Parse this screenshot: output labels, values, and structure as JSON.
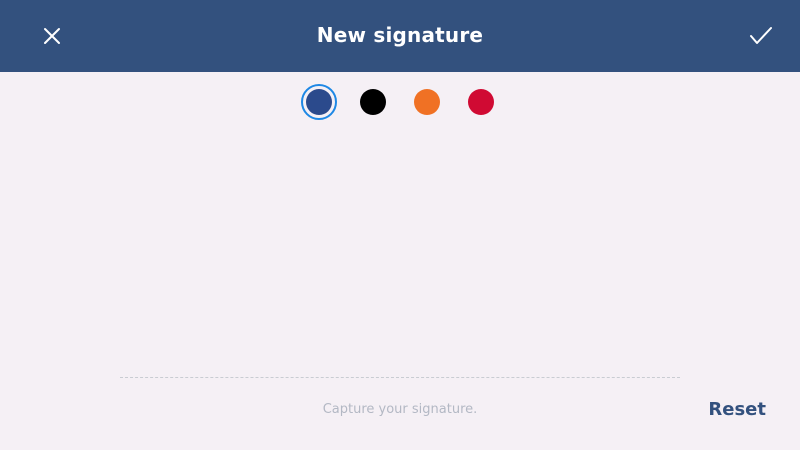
{
  "header": {
    "title": "New signature",
    "close_icon": "close-icon",
    "confirm_icon": "checkmark-icon"
  },
  "palette": {
    "selected_index": 0,
    "colors": [
      "#2b4a8c",
      "#000000",
      "#f07124",
      "#d00a33"
    ],
    "selection_ring_color": "#1e88e5"
  },
  "footer": {
    "hint": "Capture your signature.",
    "reset_label": "Reset"
  },
  "theme": {
    "header_bg": "#33517e",
    "page_bg": "#f5f0f5"
  }
}
